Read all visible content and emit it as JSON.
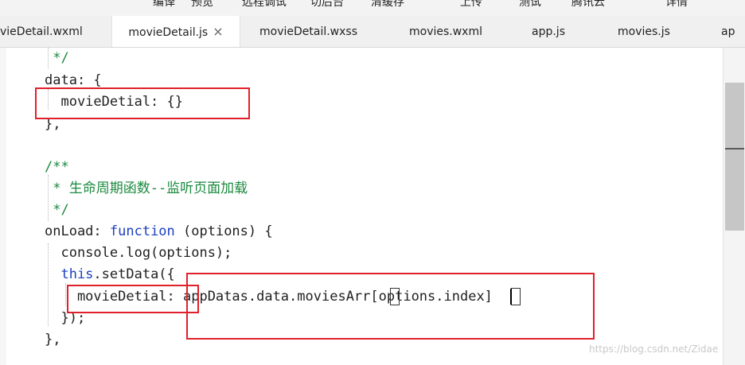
{
  "toolbar": {
    "items": [
      "编译",
      "预览",
      "远程调试",
      "切后台",
      "清缓存",
      "上传",
      "测试",
      "腾讯云",
      "详情"
    ]
  },
  "tabs": [
    {
      "label": "vieDetail.wxml"
    },
    {
      "label": "movieDetail.js",
      "close": "×"
    },
    {
      "label": "movieDetail.wxss"
    },
    {
      "label": "movies.wxml"
    },
    {
      "label": "app.js"
    },
    {
      "label": "movies.js"
    },
    {
      "label": "ap"
    }
  ],
  "code": {
    "l1": " */",
    "l2": "data: {",
    "l3": "  movieDetial: {}",
    "l4": "},",
    "l5": "/**",
    "l6": " * 生命周期函数--监听页面加载",
    "l7": " */",
    "l8_name": "onLoad: ",
    "l8_kw": "function",
    "l8_rest": " (options) {",
    "l9": "  console.log(options);",
    "l10_kw": "  this",
    "l10_rest": ".setData({",
    "l11": "    movieDetial: appDatas.data.moviesArr[options.index]",
    "l12": "  });",
    "l13": "},"
  },
  "watermark": "https://blog.csdn.net/Zidae"
}
